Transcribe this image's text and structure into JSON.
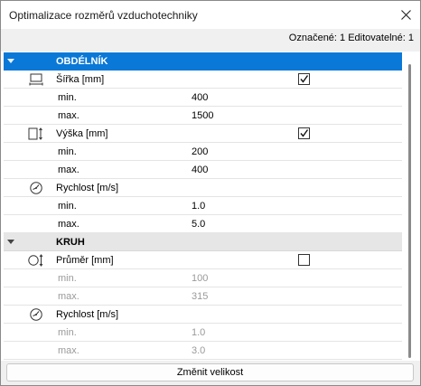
{
  "window": {
    "title": "Optimalizace rozměrů vzduchotechniky"
  },
  "selection_info": "Označené: 1 Editovatelné: 1",
  "groups": {
    "rect": {
      "label": "OBDÉLNÍK",
      "width": {
        "icon": "rect-width-icon",
        "label": "Šířka [mm]",
        "checked": true,
        "min_label": "min.",
        "min": "400",
        "max_label": "max.",
        "max": "1500"
      },
      "height": {
        "icon": "rect-height-icon",
        "label": "Výška [mm]",
        "checked": true,
        "min_label": "min.",
        "min": "200",
        "max_label": "max.",
        "max": "400"
      },
      "speed": {
        "icon": "gauge-icon",
        "label": "Rychlost [m/s]",
        "min_label": "min.",
        "min": "1.0",
        "max_label": "max.",
        "max": "5.0"
      }
    },
    "round": {
      "label": "KRUH",
      "diameter": {
        "icon": "circle-diameter-icon",
        "label": "Průměr [mm]",
        "checked": false,
        "min_label": "min.",
        "min": "100",
        "max_label": "max.",
        "max": "315"
      },
      "speed": {
        "icon": "gauge-icon",
        "label": "Rychlost [m/s]",
        "min_label": "min.",
        "min": "1.0",
        "max_label": "max.",
        "max": "3.0"
      }
    }
  },
  "footer": {
    "apply_label": "Změnit velikost"
  },
  "colors": {
    "selection": "#0a78d7",
    "group_bg": "#e6e6e6",
    "disabled_text": "#9a9a9a"
  }
}
